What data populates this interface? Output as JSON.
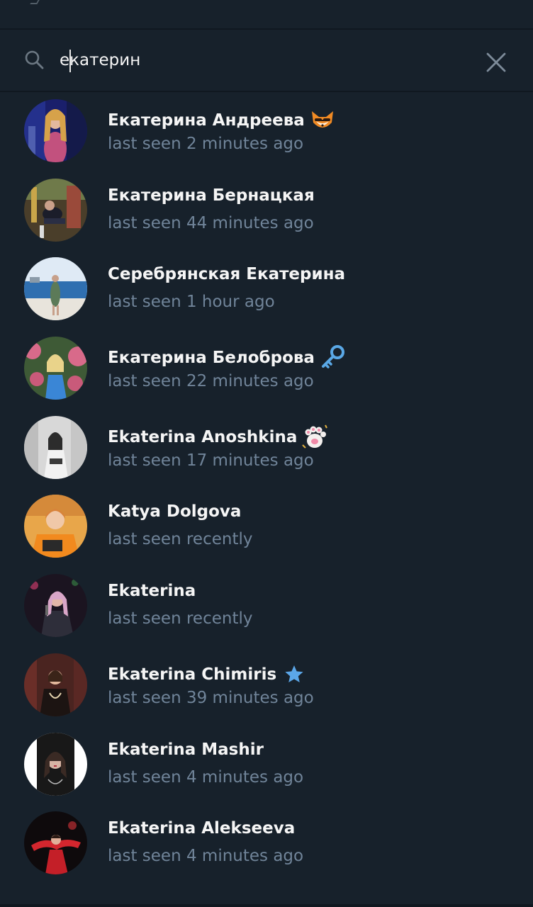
{
  "search": {
    "value": "екатерин"
  },
  "contacts": [
    {
      "name": "Екатерина Андреева",
      "status": "last seen 2 minutes ago",
      "badge": "fox-emoji-status-icon"
    },
    {
      "name": "Екатерина Бернацкая",
      "status": "last seen 44 minutes ago",
      "badge": ""
    },
    {
      "name": "Серебрянская Екатерина",
      "status": "last seen 1 hour ago",
      "badge": ""
    },
    {
      "name": "Екатерина Белоброва",
      "status": "last seen 22 minutes ago",
      "badge": "key-emoji-status-icon"
    },
    {
      "name": "Ekaterina Anoshkina",
      "status": "last seen 17 minutes ago",
      "badge": "paw-emoji-status-icon"
    },
    {
      "name": "Katya Dolgova",
      "status": "last seen recently",
      "badge": ""
    },
    {
      "name": "Ekaterina",
      "status": "last seen recently",
      "badge": ""
    },
    {
      "name": "Ekaterina Chimiris",
      "status": "last seen 39 minutes ago",
      "badge": "star-premium-icon"
    },
    {
      "name": "Ekaterina Mashir",
      "status": "last seen 4 minutes ago",
      "badge": ""
    },
    {
      "name": "Ekaterina Alekseeva",
      "status": "last seen 4 minutes ago",
      "badge": ""
    }
  ],
  "colors": {
    "background": "#17212b",
    "divider": "#101820",
    "name_text": "#f5f5f5",
    "status_text": "#708499",
    "icon": "#6c7883",
    "premium_star": "#5ba6e8"
  }
}
